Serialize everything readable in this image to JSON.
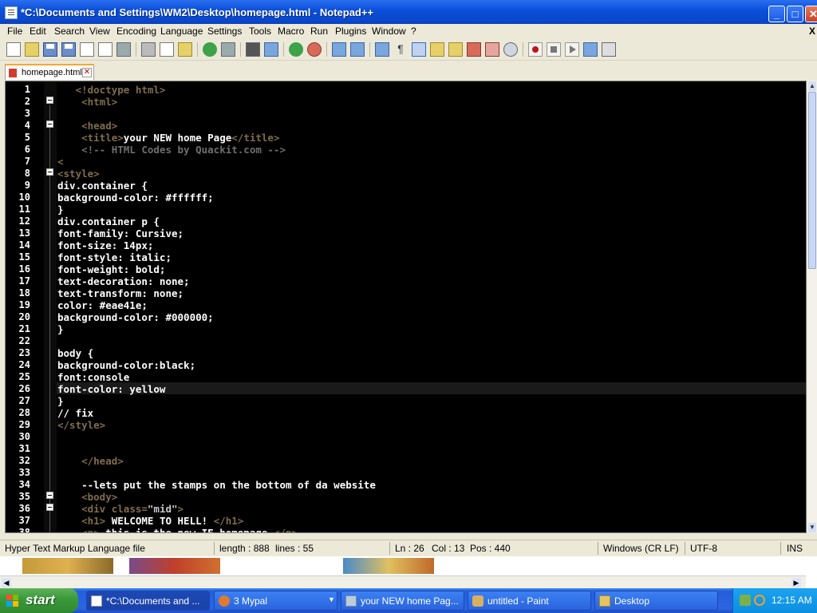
{
  "window": {
    "title": "*C:\\Documents and Settings\\WM2\\Desktop\\homepage.html - Notepad++",
    "min_label": "_",
    "max_label": "□",
    "close_label": "✕"
  },
  "menu": [
    "File",
    "Edit",
    "Search",
    "View",
    "Encoding",
    "Language",
    "Settings",
    "Tools",
    "Macro",
    "Run",
    "Plugins",
    "Window",
    "?"
  ],
  "close_doc_label": "X",
  "tab": {
    "label": "homepage.html",
    "close_label": "✕"
  },
  "code_lines": [
    {
      "n": "1",
      "html": "   <span class=\"tag\">&lt;!doctype html&gt;</span>"
    },
    {
      "n": "2",
      "html": "    <span class=\"tag\">&lt;html&gt;</span>"
    },
    {
      "n": "3",
      "html": ""
    },
    {
      "n": "4",
      "html": "    <span class=\"tag\">&lt;head&gt;</span>"
    },
    {
      "n": "5",
      "html": "    <span class=\"tag\">&lt;title&gt;</span>your NEW home Page<span class=\"tag\">&lt;/title&gt;</span>"
    },
    {
      "n": "6",
      "html": "    <span class=\"cm\">&lt;!-- HTML Codes by Quackit.com --&gt;</span>"
    },
    {
      "n": "7",
      "html": "<span class=\"tag\">&lt;</span>"
    },
    {
      "n": "8",
      "html": "<span class=\"tag\">&lt;style&gt;</span>"
    },
    {
      "n": "9",
      "html": "div.container {"
    },
    {
      "n": "10",
      "html": "background-color: #ffffff;"
    },
    {
      "n": "11",
      "html": "}"
    },
    {
      "n": "12",
      "html": "div.container p {"
    },
    {
      "n": "13",
      "html": "font-family: Cursive;"
    },
    {
      "n": "14",
      "html": "font-size: 14px;"
    },
    {
      "n": "15",
      "html": "font-style: italic;"
    },
    {
      "n": "16",
      "html": "font-weight: bold;"
    },
    {
      "n": "17",
      "html": "text-decoration: none;"
    },
    {
      "n": "18",
      "html": "text-transform: none;"
    },
    {
      "n": "19",
      "html": "color: #eae41e;"
    },
    {
      "n": "20",
      "html": "background-color: #000000;"
    },
    {
      "n": "21",
      "html": "}"
    },
    {
      "n": "22",
      "html": ""
    },
    {
      "n": "23",
      "html": "body {"
    },
    {
      "n": "24",
      "html": "background-color:black;"
    },
    {
      "n": "25",
      "html": "font:console"
    },
    {
      "n": "26",
      "html": "font-color: yellow"
    },
    {
      "n": "27",
      "html": "}"
    },
    {
      "n": "28",
      "html": "// fix"
    },
    {
      "n": "29",
      "html": "<span class=\"tag\">&lt;/style&gt;</span>"
    },
    {
      "n": "30",
      "html": ""
    },
    {
      "n": "31",
      "html": ""
    },
    {
      "n": "32",
      "html": "    <span class=\"tag\">&lt;/head&gt;</span>"
    },
    {
      "n": "33",
      "html": ""
    },
    {
      "n": "34",
      "html": "    --lets put the stamps on the bottom of da website"
    },
    {
      "n": "35",
      "html": "    <span class=\"tag\">&lt;body&gt;</span>"
    },
    {
      "n": "36",
      "html": "    <span class=\"tag\">&lt;div class=</span><span class=\"str\">\"mid\"</span><span class=\"tag\">&gt;</span>"
    },
    {
      "n": "37",
      "html": "    <span class=\"tag\">&lt;h1&gt;</span> WELCOME TO HELL! <span class=\"tag\">&lt;/h1&gt;</span>"
    },
    {
      "n": "38",
      "html": "    <span class=\"tag\">&lt;p&gt;</span> this is the new IE homepage <span class=\"tag\">&lt;/p&gt;</span>"
    }
  ],
  "status": {
    "file_type": "Hyper Text Markup Language file",
    "length": "length : 888",
    "lines": "lines : 55",
    "ln": "Ln : 26",
    "col": "Col : 13",
    "pos": "Pos : 440",
    "eol": "Windows (CR LF)",
    "encoding": "UTF-8",
    "mode": "INS"
  },
  "taskbar": {
    "start_label": "start",
    "tasks": [
      {
        "label": "*C:\\Documents and ...",
        "icon": "notepad-icon",
        "active": true
      },
      {
        "label": "3 Mypal",
        "icon": "mypal-icon",
        "active": false
      },
      {
        "label": "your NEW home Pag...",
        "icon": "browser-icon",
        "active": false
      },
      {
        "label": "untitled - Paint",
        "icon": "paint-icon",
        "active": false
      },
      {
        "label": "Desktop",
        "icon": "folder-icon",
        "active": false
      }
    ],
    "clock": "12:15 AM"
  },
  "colors": {
    "accent_selection": "#eae41e",
    "tag_color": "#806c4c",
    "editor_bg": "#000000",
    "titlebar_blue": "#0a4fd9"
  }
}
